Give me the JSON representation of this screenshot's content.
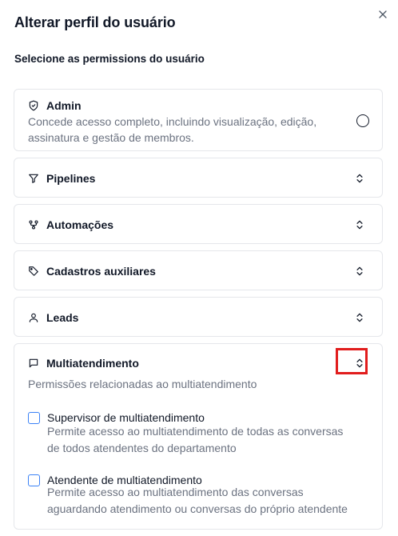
{
  "dialog": {
    "title": "Alterar perfil do usuário",
    "subtitle": "Selecione as permissions do usuário"
  },
  "admin": {
    "title": "Admin",
    "description_line1": "Concede acesso completo, incluindo visualização, edição,",
    "description_line2": "assinatura e gestão de membros."
  },
  "sections": {
    "pipelines": "Pipelines",
    "automacoes": "Automações",
    "cadastros": "Cadastros auxiliares",
    "leads": "Leads"
  },
  "multiatendimento": {
    "title": "Multiatendimento",
    "description": "Permissões relacionadas ao multiatendimento",
    "options": [
      {
        "title": "Supervisor de multiatendimento",
        "line1": "Permite acesso ao multiatendimento de todas as conversas",
        "line2": "de todos atendentes do departamento",
        "checked": false
      },
      {
        "title": "Atendente de multiatendimento",
        "line1": "Permite acesso ao multiatendimento das conversas",
        "line2": "aguardando atendimento ou conversas do próprio atendente",
        "checked": false
      }
    ]
  },
  "icons": {
    "close": "close-icon",
    "admin": "shield-icon",
    "pipelines": "filter-icon",
    "automacoes": "workflow-icon",
    "cadastros": "tag-icon",
    "leads": "user-icon",
    "multiatendimento": "message-square-icon",
    "expand": "chevrons-up-down-icon"
  },
  "colors": {
    "highlight": "#e11d1d",
    "checkbox_border": "#3b82f6",
    "muted_text": "#6b7280",
    "border": "#e5e7eb"
  }
}
